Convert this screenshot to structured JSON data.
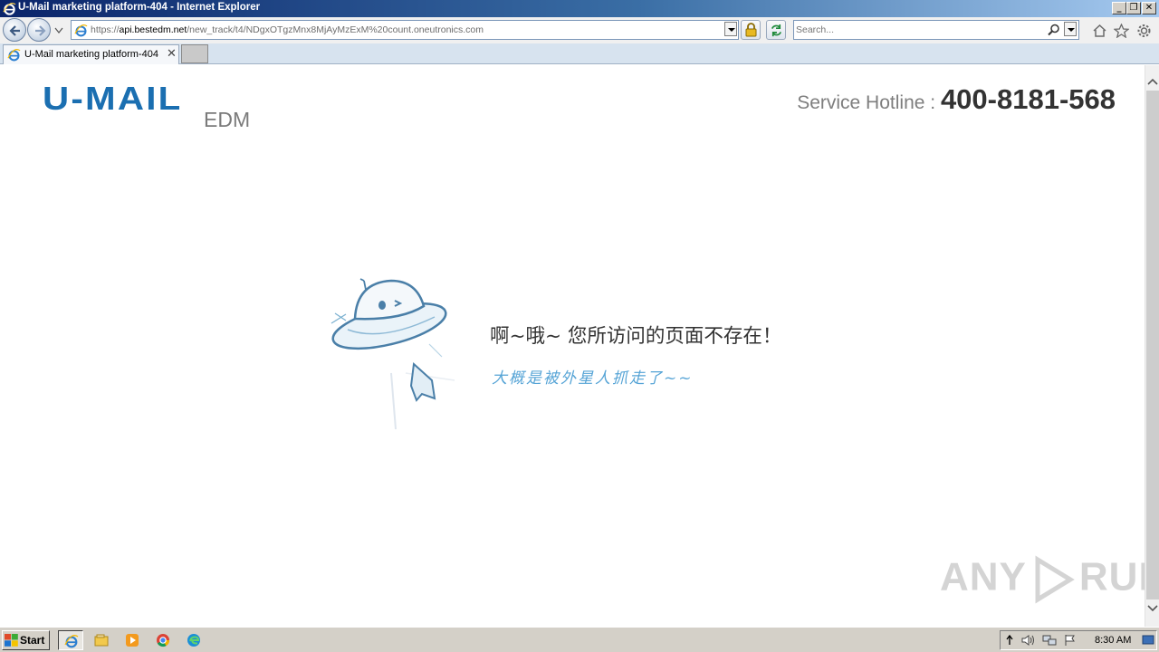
{
  "window": {
    "title": "U-Mail marketing platform-404 - Internet Explorer",
    "controls": [
      "_",
      "❐",
      "✕"
    ]
  },
  "address_bar": {
    "url_prefix": "https://",
    "url_domain": "api.bestedm.net",
    "url_rest": "/new_track/t4/NDgxOTgzMnx8MjAyMzExM%20count.oneutronics.com"
  },
  "search": {
    "placeholder": "Search..."
  },
  "tabs": [
    {
      "label": "U-Mail marketing platform-404",
      "close": "✕"
    }
  ],
  "page": {
    "logo_text": "U-MAIL",
    "logo_suffix": "EDM",
    "hotline_label": "Service Hotline : ",
    "hotline_number": "400-8181-568",
    "error_title": "啊~哦~ 您所访问的页面不存在！",
    "error_subtitle": "大概是被外星人抓走了~~",
    "illustration": "ufo-icon",
    "brand_color": "#1b6fb1",
    "accent_color": "#56a4d6"
  },
  "watermark": {
    "left": "ANY",
    "right": "RUN"
  },
  "taskbar": {
    "start_label": "Start",
    "apps": [
      "ie-icon",
      "explorer-icon",
      "media-player-icon",
      "chrome-icon",
      "edge-icon"
    ],
    "tray_icons": [
      "tray-expand-icon",
      "volume-icon",
      "network-icon",
      "flag-icon"
    ],
    "clock": "8:30 AM"
  }
}
